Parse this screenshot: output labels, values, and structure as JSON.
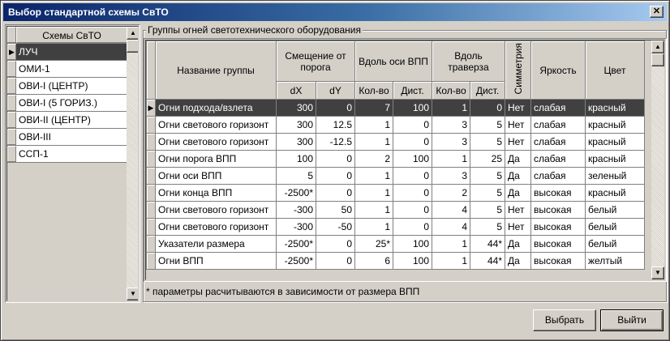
{
  "window": {
    "title": "Выбор стандартной схемы СвТО",
    "close_glyph": "✕"
  },
  "schemes": {
    "header": "Схемы СвТО",
    "items": [
      "ЛУЧ",
      "ОМИ-1",
      "ОВИ-I (ЦЕНТР)",
      "ОВИ-I (5 ГОРИЗ.)",
      "ОВИ-II (ЦЕНТР)",
      "ОВИ-III",
      "ССП-1"
    ],
    "selected_index": 0
  },
  "groups": {
    "box_title": "Группы огней светотехнического оборудования",
    "headers": {
      "name": "Название группы",
      "offset": "Смещение от порога",
      "dx": "dX",
      "dy": "dY",
      "axis": "Вдоль оси ВПП",
      "axis_count": "Кол-во",
      "axis_dist": "Дист.",
      "traverse": "Вдоль траверза",
      "trav_count": "Кол-во",
      "trav_dist": "Дист.",
      "symmetry": "Симметрия",
      "brightness": "Яркость",
      "color": "Цвет"
    },
    "rows": [
      {
        "name": "Огни подхода/взлета",
        "dx": "300",
        "dy": "0",
        "axis_count": "7",
        "axis_dist": "100",
        "trav_count": "1",
        "trav_dist": "0",
        "symmetry": "Нет",
        "brightness": "слабая",
        "color": "красный"
      },
      {
        "name": "Огни светового горизонт",
        "dx": "300",
        "dy": "12.5",
        "axis_count": "1",
        "axis_dist": "0",
        "trav_count": "3",
        "trav_dist": "5",
        "symmetry": "Нет",
        "brightness": "слабая",
        "color": "красный"
      },
      {
        "name": "Огни светового горизонт",
        "dx": "300",
        "dy": "-12.5",
        "axis_count": "1",
        "axis_dist": "0",
        "trav_count": "3",
        "trav_dist": "5",
        "symmetry": "Нет",
        "brightness": "слабая",
        "color": "красный"
      },
      {
        "name": "Огни порога ВПП",
        "dx": "100",
        "dy": "0",
        "axis_count": "2",
        "axis_dist": "100",
        "trav_count": "1",
        "trav_dist": "25",
        "symmetry": "Да",
        "brightness": "слабая",
        "color": "красный"
      },
      {
        "name": "Огни оси ВПП",
        "dx": "5",
        "dy": "0",
        "axis_count": "1",
        "axis_dist": "0",
        "trav_count": "3",
        "trav_dist": "5",
        "symmetry": "Да",
        "brightness": "слабая",
        "color": "зеленый"
      },
      {
        "name": "Огни конца ВПП",
        "dx": "-2500*",
        "dy": "0",
        "axis_count": "1",
        "axis_dist": "0",
        "trav_count": "2",
        "trav_dist": "5",
        "symmetry": "Да",
        "brightness": "высокая",
        "color": "красный"
      },
      {
        "name": "Огни светового горизонт",
        "dx": "-300",
        "dy": "50",
        "axis_count": "1",
        "axis_dist": "0",
        "trav_count": "4",
        "trav_dist": "5",
        "symmetry": "Нет",
        "brightness": "высокая",
        "color": "белый"
      },
      {
        "name": "Огни светового горизонт",
        "dx": "-300",
        "dy": "-50",
        "axis_count": "1",
        "axis_dist": "0",
        "trav_count": "4",
        "trav_dist": "5",
        "symmetry": "Нет",
        "brightness": "высокая",
        "color": "белый"
      },
      {
        "name": "Указатели размера",
        "dx": "-2500*",
        "dy": "0",
        "axis_count": "25*",
        "axis_dist": "100",
        "trav_count": "1",
        "trav_dist": "44*",
        "symmetry": "Да",
        "brightness": "высокая",
        "color": "белый"
      },
      {
        "name": "Огни ВПП",
        "dx": "-2500*",
        "dy": "0",
        "axis_count": "6",
        "axis_dist": "100",
        "trav_count": "1",
        "trav_dist": "44*",
        "symmetry": "Да",
        "brightness": "высокая",
        "color": "желтый"
      }
    ],
    "selected_index": 0,
    "footnote": "* параметры расчитываются в зависимости от размера ВПП"
  },
  "buttons": {
    "select": "Выбрать",
    "exit": "Выйти"
  },
  "icons": {
    "row_pointer": "▶",
    "scroll_up": "▲",
    "scroll_down": "▼"
  }
}
